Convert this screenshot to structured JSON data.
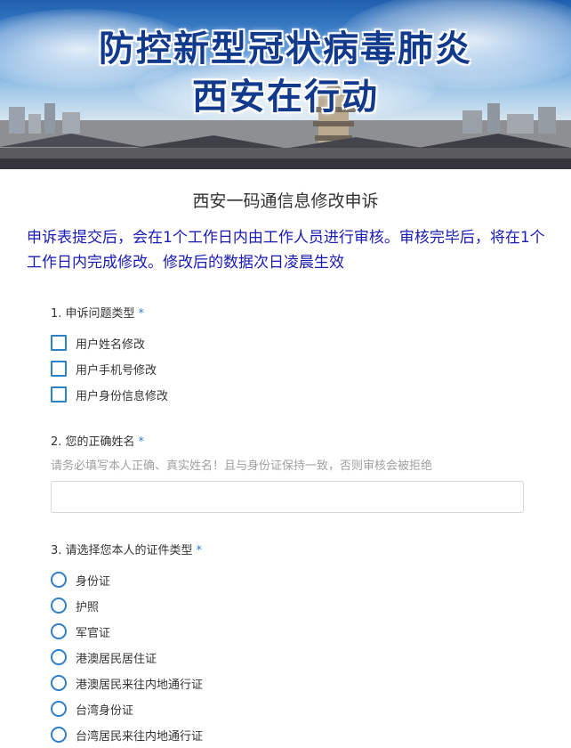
{
  "banner": {
    "line1": "防控新型冠状病毒肺炎",
    "line2": "西安在行动"
  },
  "form": {
    "title": "西安一码通信息修改申诉",
    "notice": "申诉表提交后，会在1个工作日内由工作人员进行审核。审核完毕后，将在1个工作日内完成修改。修改后的数据次日凌晨生效"
  },
  "questions": {
    "q1": {
      "title": "1. 申诉问题类型",
      "required_mark": "*",
      "options": [
        "用户姓名修改",
        "用户手机号修改",
        "用户身份信息修改"
      ]
    },
    "q2": {
      "title": "2. 您的正确姓名",
      "required_mark": "*",
      "hint": "请务必填写本人正确、真实姓名！且与身份证保持一致，否则审核会被拒绝",
      "value": ""
    },
    "q3": {
      "title": "3. 请选择您本人的证件类型",
      "required_mark": "*",
      "options": [
        "身份证",
        "护照",
        "军官证",
        "港澳居民居住证",
        "港澳居民来往内地通行证",
        "台湾身份证",
        "台湾居民来往内地通行证"
      ]
    }
  },
  "colors": {
    "notice_text": "#1a1ab4",
    "accent": "#2f7fc9",
    "required": "#2d7bd6"
  }
}
